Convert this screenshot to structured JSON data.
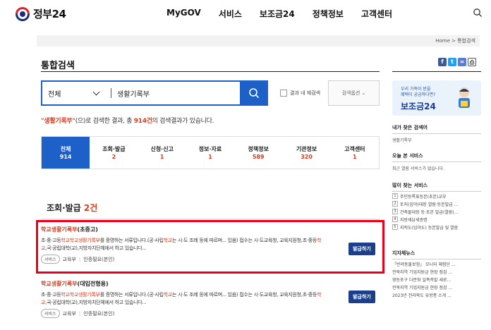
{
  "header": {
    "logo": "정부24",
    "nav": [
      "MyGOV",
      "서비스",
      "보조금24",
      "정책정보",
      "고객센터"
    ]
  },
  "breadcrumb": "Home > 통합검색",
  "page_title": "통합검색",
  "share_icons": [
    "facebook-icon",
    "twitter-icon",
    "link-icon",
    "print-icon"
  ],
  "search": {
    "scope": "전체",
    "query": "생활기록부",
    "within_label": "결과 내 재검색",
    "options_label": "검색옵션"
  },
  "summary": {
    "keyword": "\"생활기록부\"",
    "before": "(으)로 검색한 결과, 총 ",
    "count": "914건",
    "after": "의 검색결과가 있습니다."
  },
  "tabs": [
    {
      "label": "전체",
      "count": "914",
      "active": true
    },
    {
      "label": "조회·발급",
      "count": "2",
      "active": false
    },
    {
      "label": "신청·신고",
      "count": "1",
      "active": false
    },
    {
      "label": "정보·자료",
      "count": "1",
      "active": false
    },
    {
      "label": "정책정보",
      "count": "589",
      "active": false
    },
    {
      "label": "기관정보",
      "count": "320",
      "active": false
    },
    {
      "label": "고객센터",
      "count": "1",
      "active": false
    }
  ],
  "section": {
    "title": "조회·발급",
    "count": "2건"
  },
  "results": [
    {
      "title_hl": "학교생활기록부",
      "title_rest": "(초중고)",
      "desc_parts": [
        "초·중·고등",
        "학교학교생활기록부",
        "를 증명하는 서류입니다.(공·사립",
        "학교",
        "는 시·도 조례 등에 따르며... 있음) 접수는 시·도교육청, 교육지원청,초·중등",
        "학교",
        ",국·공립대학(교),지방자치단체에서 하고 있습니다..."
      ],
      "badge": "서비스",
      "org": "교육부",
      "auth": "인증필요(본인)",
      "button": "발급하기"
    },
    {
      "title_hl": "학교생활기록부",
      "title_rest": "(대입전형용)",
      "desc_parts": [
        "초·중·고등",
        "학교학교생활기록부",
        "를 증명하는 서류입니다.(공·사립",
        "학교",
        "는 시·도 조례 등에 따르며... 있음) 접수는 시·도교육청, 교육지원청,초·중등",
        "학교",
        ",국·공립대학(교),지방자치단체에서 하고 있습니다..."
      ],
      "badge": "서비스",
      "org": "교육부",
      "auth": "인증필요(본인)",
      "button": "발급하기"
    }
  ],
  "sidebar": {
    "promo_line1": "우리 가족이 받을",
    "promo_line2": "혜택이 궁금하다면?",
    "promo_title": "보조금24",
    "my_searches": {
      "title": "내가 찾은 검색어",
      "items": [
        "생활기록부"
      ]
    },
    "today_services": {
      "title": "오늘 본 서비스",
      "items": [
        "최근 열람 서비스가 없습니다."
      ]
    },
    "popular_services": {
      "title": "많이 찾는 서비스",
      "items": [
        "주민등록표등본(초본)교부",
        "토지(임야)대장 열람·등본발급 ...",
        "건축물대장 등·초본 발급(열람)...",
        "지방세납세증명",
        "지적도(임야도) 등본발급 및 열람"
      ]
    },
    "news": {
      "title": "지자체뉴스",
      "items": [
        "「반려동물보험」 모니터 체험단 ...",
        "전북지역 기업지원금 현장 점검 ...",
        "영등포구 다문화 일촉즉발 새로...",
        "전북지역 기업지원금 현장 점검 ...",
        "2023년 전라북도 유방종 소개 ..."
      ]
    },
    "colors": {
      "accent": "#1d60c8",
      "highlight": "#d63d1e",
      "alert_box": "#e8001b"
    }
  }
}
